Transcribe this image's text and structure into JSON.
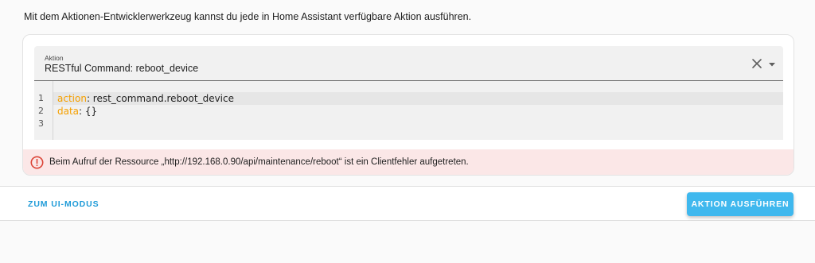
{
  "description": "Mit dem Aktionen-Entwicklerwerkzeug kannst du jede in Home Assistant verfügbare Aktion ausführen.",
  "action_select": {
    "label": "Aktion",
    "value": "RESTful Command: reboot_device",
    "icons": {
      "clear": "close-icon",
      "dropdown": "menu-down-icon"
    }
  },
  "editor": {
    "line_numbers": [
      "1",
      "2",
      "3"
    ],
    "lines": [
      {
        "key": "action",
        "sep": ": ",
        "value": "rest_command.reboot_device"
      },
      {
        "key": "data",
        "sep": ": ",
        "value": "{}"
      },
      {
        "key": "",
        "sep": "",
        "value": ""
      }
    ]
  },
  "error": {
    "icon": "alert-circle-outline-icon",
    "message": "Beim Aufruf der Ressource „http://192.168.0.90/api/maintenance/reboot“ ist ein Clientfehler aufgetreten."
  },
  "footer": {
    "ui_mode_label": "ZUM UI-MODUS",
    "run_label": "AKTION AUSFÜHREN"
  },
  "colors": {
    "primary": "#3fb8ee",
    "link": "#1f9bd8",
    "error": "#db4437",
    "error_background": "#fbe7e7",
    "yaml_key": "#f5a000"
  }
}
